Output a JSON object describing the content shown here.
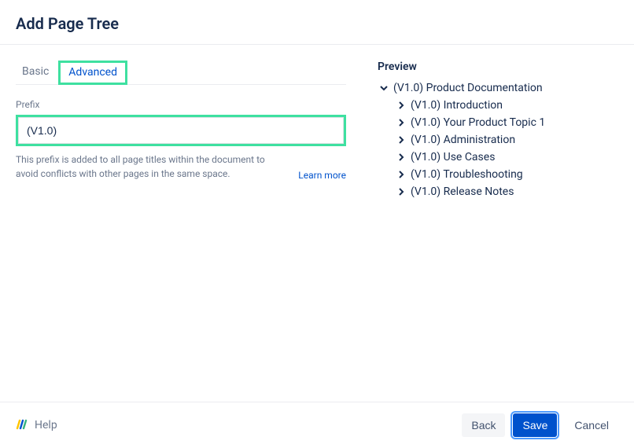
{
  "header": {
    "title": "Add Page Tree"
  },
  "tabs": {
    "basic": "Basic",
    "advanced": "Advanced"
  },
  "form": {
    "prefix_label": "Prefix",
    "prefix_value": "(V1.0)",
    "help_text": "This prefix is added to all page titles within the document to avoid conflicts with other pages in the same space.",
    "learn_more": "Learn more"
  },
  "preview": {
    "title": "Preview",
    "root": "(V1.0) Product Documentation",
    "items": [
      "(V1.0) Introduction",
      "(V1.0) Your Product Topic 1",
      "(V1.0) Administration",
      "(V1.0) Use Cases",
      "(V1.0) Troubleshooting",
      "(V1.0) Release Notes"
    ]
  },
  "footer": {
    "help": "Help",
    "back": "Back",
    "save": "Save",
    "cancel": "Cancel"
  }
}
